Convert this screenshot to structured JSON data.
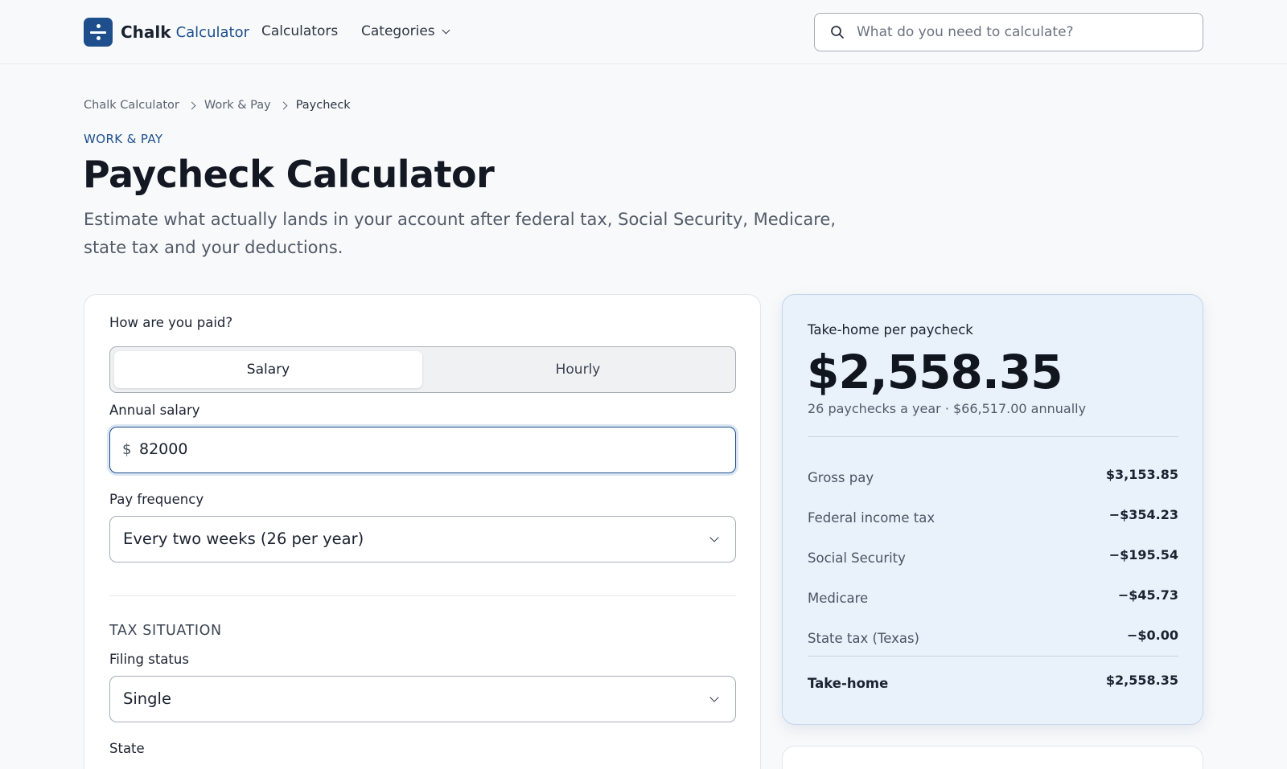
{
  "header": {
    "brand_name": "Chalk",
    "brand_sub": "Calculator",
    "nav": {
      "calculators": "Calculators",
      "categories": "Categories"
    },
    "search": {
      "placeholder": "What do you need to calculate?"
    }
  },
  "breadcrumb": [
    "Chalk Calculator",
    "Work & Pay",
    "Paycheck"
  ],
  "page": {
    "eyebrow": "WORK & PAY",
    "title": "Paycheck Calculator",
    "description": "Estimate what actually lands in your account after federal tax, Social Security, Medicare, state tax and your deductions."
  },
  "form": {
    "paid_label": "How are you paid?",
    "pay_types": [
      "Salary",
      "Hourly"
    ],
    "selected_pay_type": "Salary",
    "salary_label": "Annual salary",
    "currency_prefix": "$",
    "salary_value": "82000",
    "frequency_label": "Pay frequency",
    "frequency_value": "Every two weeks (26 per year)",
    "section_title": "TAX SITUATION",
    "filing_label": "Filing status",
    "filing_value": "Single",
    "state_label": "State"
  },
  "result": {
    "label": "Take-home per paycheck",
    "amount": "$2,558.35",
    "subtitle": "26 paychecks a year · $66,517.00 annually",
    "rows": [
      {
        "label": "Gross pay",
        "value": "$3,153.85"
      },
      {
        "label": "Federal income tax",
        "value": "−$354.23"
      },
      {
        "label": "Social Security",
        "value": "−$195.54"
      },
      {
        "label": "Medicare",
        "value": "−$45.73"
      },
      {
        "label": "State tax (Texas)",
        "value": "−$0.00"
      }
    ],
    "total": {
      "label": "Take-home",
      "value": "$2,558.35"
    }
  },
  "colors": {
    "brand": "#1e4f8c",
    "background": "#f8f9fa",
    "result_card": "#e9f1fb"
  }
}
